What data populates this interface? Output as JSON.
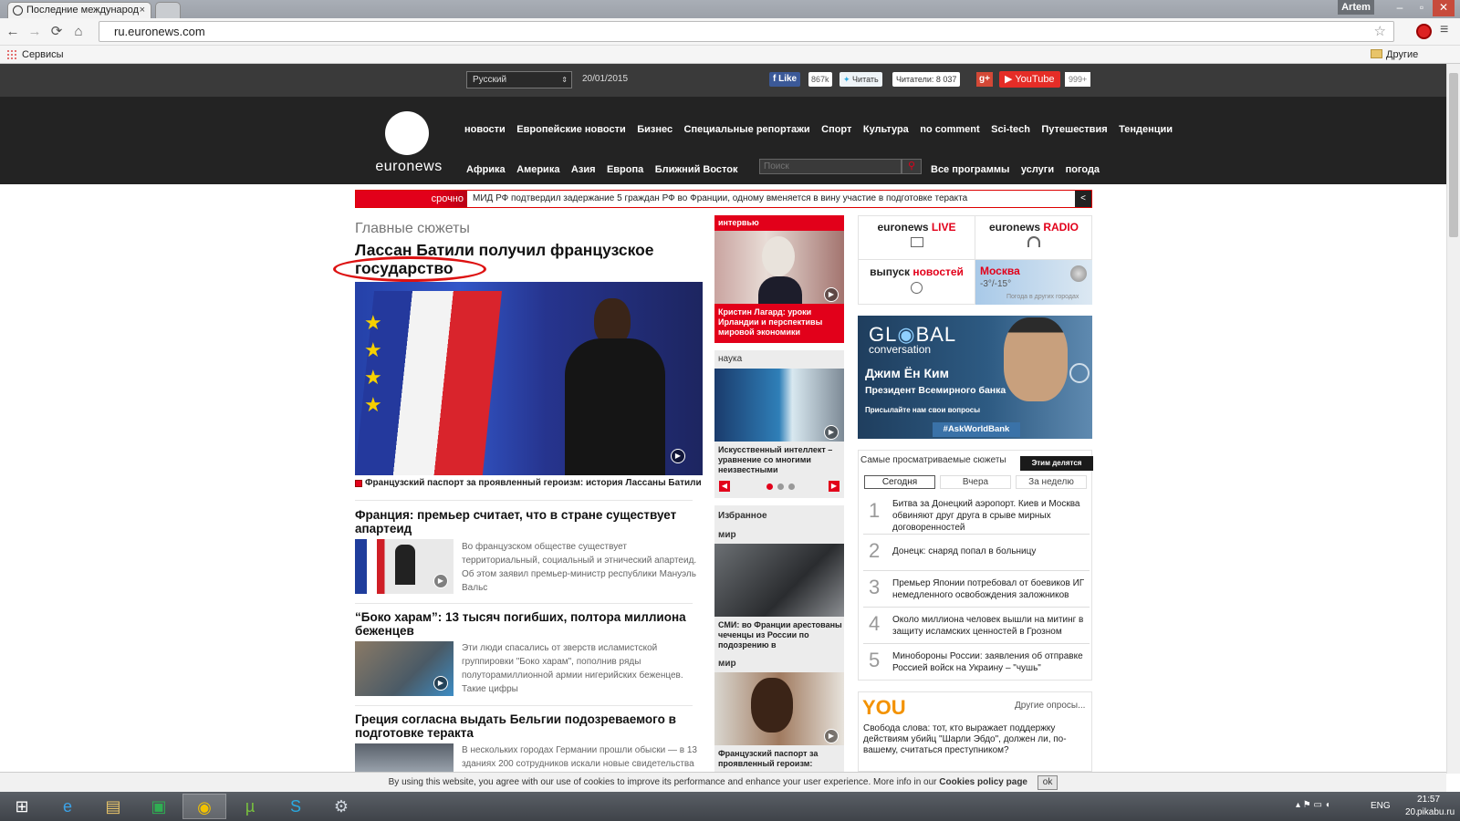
{
  "browser": {
    "tab_title": "Последние международ",
    "tab_close": "×",
    "user": "Artem",
    "url": "ru.euronews.com",
    "bookmarks_label": "Сервисы",
    "other_bookmarks": "Другие закладки"
  },
  "topbar": {
    "language": "Русский",
    "date": "20/01/2015",
    "fb_like": "Like",
    "fb_count": "867k",
    "twitter_label": "Читать",
    "twitter_readers": "Читатели: 8 037",
    "gplus": "g+",
    "youtube": "YouTube",
    "youtube_count": "999+"
  },
  "header": {
    "logo_text": "euronews",
    "nav_main": [
      "новости",
      "Европейские новости",
      "Бизнес",
      "Специальные репортажи",
      "Спорт",
      "Культура",
      "no comment",
      "Sci-tech",
      "Путешествия",
      "Тенденции"
    ],
    "nav_regions": [
      "Африка",
      "Америка",
      "Азия",
      "Европа",
      "Ближний Восток"
    ],
    "search_placeholder": "Поиск",
    "nav_right": [
      "Все программы",
      "услуги",
      "погода"
    ]
  },
  "breaking": {
    "label": "срочно",
    "text": "МИД РФ подтвердил задержание 5 граждан РФ во Франции, одному вменяется в вину участие в подготовке теракта"
  },
  "main": {
    "section_title": "Главные сюжеты",
    "lead_title": "Лассан Батили получил французское государство",
    "lead_caption": "Французский паспорт за проявленный героизм: история Лассаны Батили",
    "stories": [
      {
        "title": "Франция: премьер считает, что в стране существует апартеид",
        "text": "Во французском обществе существует территориальный, социальный и этнический апартеид. Об этом заявил премьер-министр республики Мануэль Вальс"
      },
      {
        "title": "“Боко харам”: 13 тысяч погибших, полтора миллиона беженцев",
        "text": "Эти люди спасались от зверств исламистской группировки \"Боко харам\", пополнив ряды полуторамиллионной армии нигерийских беженцев. Такие цифры"
      },
      {
        "title": "Греция согласна выдать Бельгии подозреваемого в подготовке теракта",
        "text": "В нескольких городах Германии прошли обыски — в 13 зданиях 200 сотрудников искали новые свидетельства"
      }
    ]
  },
  "middle": {
    "interview_label": "интервью",
    "interview_caption": "Кристин Лагард: уроки Ирландии и перспективы мировой экономики",
    "science_label": "наука",
    "science_caption": "Искусственный интеллект – уравнение со многими неизвестными",
    "featured_label": "Избранное",
    "world_label": "мир",
    "world_caption": "СМИ: во Франции арестованы чеченцы из России по подозрению в",
    "world2_label": "мир",
    "world2_caption": "Французский паспорт за проявленный героизм:"
  },
  "right": {
    "live_a": "euronews ",
    "live_b": "LIVE",
    "radio_a": "euronews ",
    "radio_b": "RADIO",
    "release_a": "выпуск ",
    "release_b": "новостей",
    "weather_city": "Москва",
    "weather_temp": "-3°/-15°",
    "weather_other": "Погода в других городах",
    "ad_brand_a": "GL",
    "ad_brand_b": "BAL",
    "ad_brand_c": "conversation",
    "ad_name": "Джим Ён Ким",
    "ad_role": "Президент Всемирного банка",
    "ad_cta": "Присылайте нам свои вопросы",
    "ad_hashtag": "#AskWorldBank",
    "most_viewed": "Самые просматриваемые сюжеты",
    "shared": "Этим делятся",
    "periods": [
      "Сегодня",
      "Вчера",
      "За неделю"
    ],
    "top_list": [
      "Битва за Донецкий аэропорт. Киев и Москва обвиняют друг друга в срыве мирных договоренностей",
      "Донецк: снаряд попал в больницу",
      "Премьер Японии потребовал от боевиков ИГ немедленного освобождения заложников",
      "Около миллиона человек вышли на митинг в защиту исламских ценностей в Грозном",
      "Минобороны России: заявления об отправке Россией войск на Украину – \"чушь\""
    ],
    "top_numbers": [
      "1",
      "2",
      "3",
      "4",
      "5"
    ],
    "you_logo": "YOU",
    "other_polls": "Другие опросы...",
    "poll_question": "Свобода слова: тот, кто выражает поддержку действиям убийц \"Шарли Эбдо\", должен ли, по-вашему, считаться преступником?"
  },
  "cookie": {
    "text": "By using this website, you agree with our use of cookies to improve its performance and enhance your user experience. More info in our ",
    "link": "Cookies policy page",
    "ok": "ok"
  },
  "taskbar": {
    "lang": "ENG",
    "time": "21:57",
    "date": "20.",
    "watermark": "pikabu.ru"
  },
  "colors": {
    "accent_red": "#e2001a",
    "header_bg": "#232323",
    "topbar_bg": "#3a3a3a"
  }
}
